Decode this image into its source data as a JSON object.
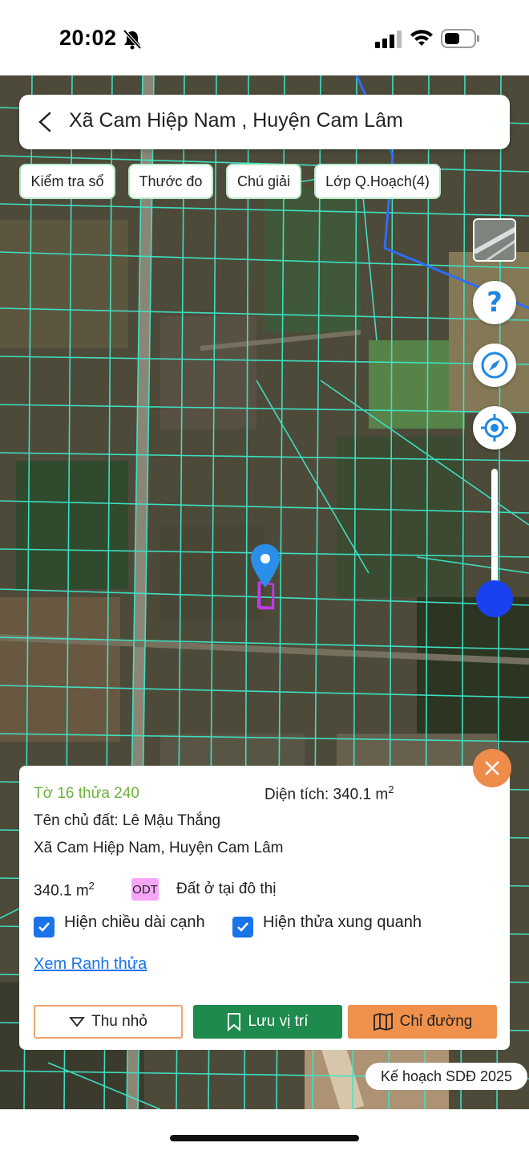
{
  "status_bar": {
    "time": "20:02",
    "icons": [
      "bell-slash-icon",
      "signal-icon",
      "wifi-icon",
      "battery-icon"
    ]
  },
  "header": {
    "title": "Xã Cam Hiệp Nam , Huyện Cam Lâm",
    "back_icon": "chevron-left-icon"
  },
  "toolbar": {
    "chips": [
      {
        "label": "Kiểm tra sổ"
      },
      {
        "label": "Thước đo"
      },
      {
        "label": "Chú giải"
      },
      {
        "label": "Lớp Q.Hoạch(4)"
      }
    ]
  },
  "map_controls": {
    "icons": [
      "layer-thumbnail",
      "help-icon",
      "compass-icon",
      "locate-icon"
    ],
    "help_glyph": "?",
    "zoom_level_fraction": 0.0
  },
  "parcel": {
    "id_text": "Tờ 16 thửa 240",
    "area_label": "Diện tích: 340.1 m",
    "area_unit_sup": "2",
    "owner": "Tên chủ đất: Lê Mậu Thắng",
    "address": "Xã Cam Hiệp Nam, Huyện Cam Lâm",
    "area_value": "340.1 m",
    "area_value_sup": "2",
    "land_code": "ODT",
    "land_type": "Đất ở tại đô thị",
    "checkboxes": [
      {
        "label": "Hiện chiều dài cạnh",
        "checked": true
      },
      {
        "label": "Hiện thửa xung quanh",
        "checked": true
      }
    ],
    "boundary_link": "Xem Ranh thửa"
  },
  "actions": {
    "shrink_label": "Thu nhỏ",
    "save_label": "Lưu vị trí",
    "route_label": "Chỉ đường"
  },
  "plan_badge": "Kế hoạch SDĐ 2025",
  "colors": {
    "parcel_lines": "#3ee6c8",
    "planning_line": "#2f6df5",
    "save_button": "#1e8a4e",
    "route_button": "#f0914b",
    "close_button": "#f08c4b",
    "parcel_id": "#6cb23a",
    "land_code_bg": "#f7a6f7",
    "link": "#1a73e8",
    "pin": "#2a8fe8"
  }
}
